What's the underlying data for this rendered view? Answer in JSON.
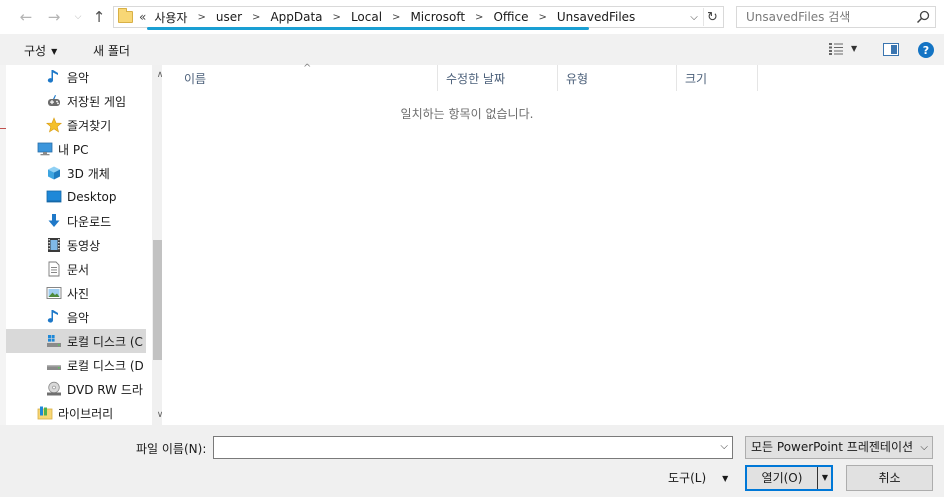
{
  "address": {
    "lead": "«",
    "crumbs": [
      "사용자",
      "user",
      "AppData",
      "Local",
      "Microsoft",
      "Office",
      "UnsavedFiles"
    ]
  },
  "search": {
    "placeholder": "UnsavedFiles 검색"
  },
  "toolbar": {
    "organize_label": "구성",
    "new_folder_label": "새 폴더"
  },
  "nav": {
    "items": [
      {
        "label": "음악",
        "icon": "music-icon"
      },
      {
        "label": "저장된 게임",
        "icon": "saved-games-icon"
      },
      {
        "label": "즐겨찾기",
        "icon": "star-icon"
      },
      {
        "label": "내 PC",
        "icon": "computer-icon"
      },
      {
        "label": "3D 개체",
        "icon": "3d-objects-icon"
      },
      {
        "label": "Desktop",
        "icon": "desktop-icon"
      },
      {
        "label": "다운로드",
        "icon": "download-icon"
      },
      {
        "label": "동영상",
        "icon": "video-icon"
      },
      {
        "label": "문서",
        "icon": "document-icon"
      },
      {
        "label": "사진",
        "icon": "picture-icon"
      },
      {
        "label": "음악",
        "icon": "music-icon"
      },
      {
        "label": "로컬 디스크 (C",
        "icon": "windows-drive-icon"
      },
      {
        "label": "로컬 디스크 (D",
        "icon": "drive-icon"
      },
      {
        "label": "DVD RW 드라",
        "icon": "dvd-drive-icon"
      },
      {
        "label": "라이브러리",
        "icon": "library-icon"
      }
    ]
  },
  "columns": [
    "이름",
    "수정한 날짜",
    "유형",
    "크기"
  ],
  "empty_message": "일치하는 항목이 없습니다.",
  "bottom": {
    "file_name_label": "파일 이름(N):",
    "file_name_value": "",
    "file_type": "모든 PowerPoint 프레젠테이션",
    "tools_label": "도구(L)",
    "open_label": "열기(O)",
    "cancel_label": "취소"
  },
  "colors": {
    "accent": "#1a9fd3",
    "focus": "#0078d7",
    "help": "#1474c4"
  }
}
